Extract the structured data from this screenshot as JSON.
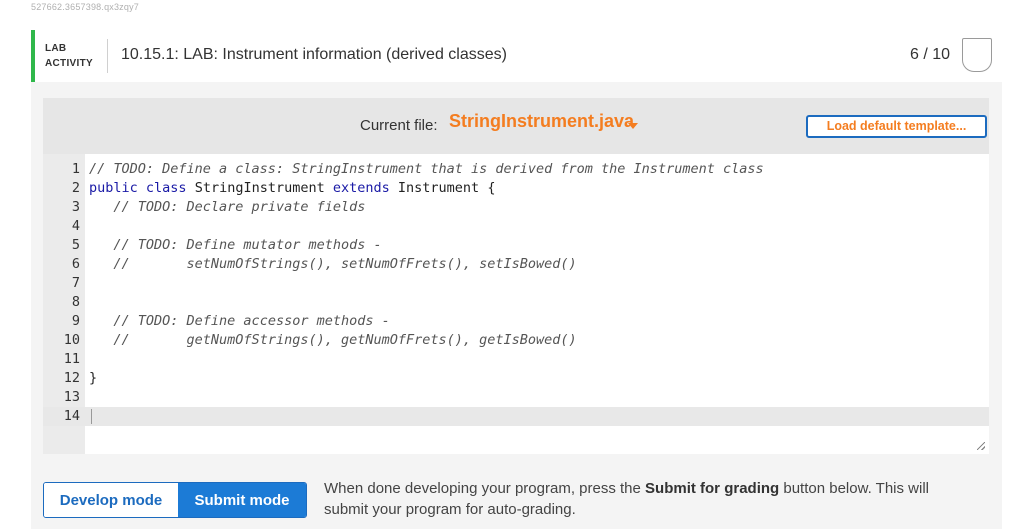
{
  "session_id": "527662.3657398.qx3zqy7",
  "activity": {
    "type_line1": "LAB",
    "type_line2": "ACTIVITY",
    "title": "10.15.1: LAB: Instrument information (derived classes)",
    "score": "6 / 10"
  },
  "file_bar": {
    "label": "Current file:",
    "file_name": "StringInstrument.java",
    "load_template_label": "Load default template..."
  },
  "code_lines": [
    {
      "n": "1",
      "segments": [
        {
          "t": "// TODO: Define a class: StringInstrument that is derived from the Instrument class",
          "c": "cm"
        }
      ]
    },
    {
      "n": "2",
      "segments": [
        {
          "t": "public",
          "c": "kw"
        },
        {
          "t": " ",
          "c": ""
        },
        {
          "t": "class",
          "c": "kw"
        },
        {
          "t": " StringInstrument ",
          "c": ""
        },
        {
          "t": "extends",
          "c": "kw"
        },
        {
          "t": " Instrument {",
          "c": ""
        }
      ]
    },
    {
      "n": "3",
      "segments": [
        {
          "t": "   ",
          "c": ""
        },
        {
          "t": "// TODO: Declare private fields",
          "c": "cm"
        }
      ]
    },
    {
      "n": "4",
      "segments": []
    },
    {
      "n": "5",
      "segments": [
        {
          "t": "   ",
          "c": ""
        },
        {
          "t": "// TODO: Define mutator methods -",
          "c": "cm"
        }
      ]
    },
    {
      "n": "6",
      "segments": [
        {
          "t": "   ",
          "c": ""
        },
        {
          "t": "//       setNumOfStrings(), setNumOfFrets(), setIsBowed()",
          "c": "cm"
        }
      ]
    },
    {
      "n": "7",
      "segments": []
    },
    {
      "n": "8",
      "segments": []
    },
    {
      "n": "9",
      "segments": [
        {
          "t": "   ",
          "c": ""
        },
        {
          "t": "// TODO: Define accessor methods -",
          "c": "cm"
        }
      ]
    },
    {
      "n": "10",
      "segments": [
        {
          "t": "   ",
          "c": ""
        },
        {
          "t": "//       getNumOfStrings(), getNumOfFrets(), getIsBowed()",
          "c": "cm"
        }
      ]
    },
    {
      "n": "11",
      "segments": []
    },
    {
      "n": "12",
      "segments": [
        {
          "t": "}",
          "c": ""
        }
      ]
    },
    {
      "n": "13",
      "segments": []
    },
    {
      "n": "14",
      "segments": [],
      "active": true
    }
  ],
  "modes": {
    "develop_label": "Develop mode",
    "submit_label": "Submit mode"
  },
  "instructions": {
    "before": "When done developing your program, press the ",
    "bold": "Submit for grading",
    "after": " button below. This will submit your program for auto-grading."
  },
  "colors": {
    "accent_green": "#2fb84b",
    "accent_orange": "#f47d20",
    "accent_blue": "#1c6bbf"
  }
}
